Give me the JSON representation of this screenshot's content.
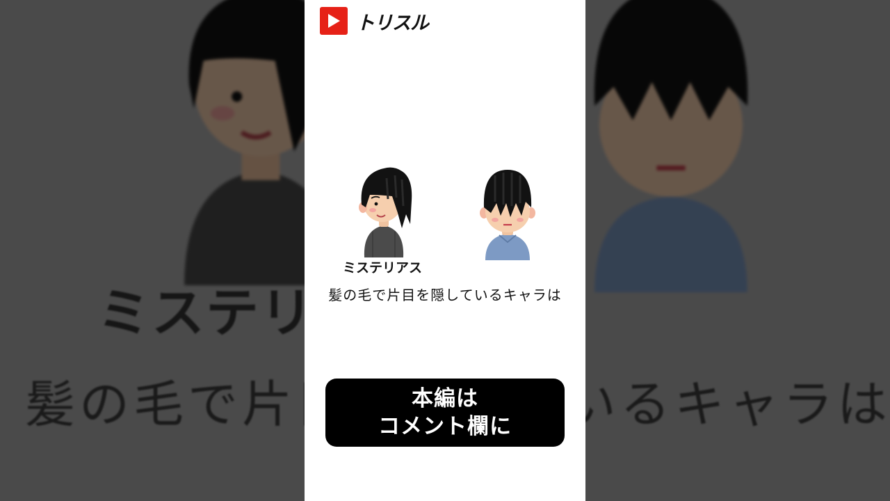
{
  "brand": {
    "name": "トリスル",
    "icon": "play-icon",
    "color": "#e62117"
  },
  "characters": [
    {
      "name": "mysterious-character",
      "caption": "ミステリアス"
    },
    {
      "name": "hidden-eyes-character"
    }
  ],
  "question": "髪の毛で片目を隠しているキャラは",
  "cta": {
    "line1": "本編は",
    "line2": "コメント欄に"
  },
  "backdrop": {
    "caption": "ミステリアス",
    "question": "髪の毛で片目を隠しているキャラは"
  }
}
